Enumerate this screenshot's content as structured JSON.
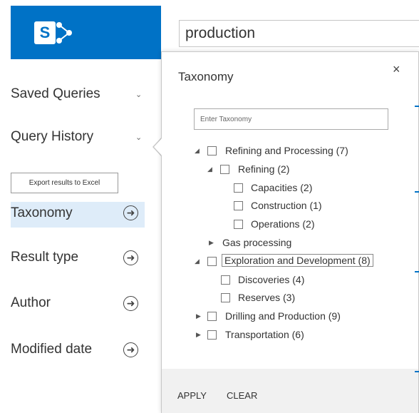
{
  "logo": {
    "letter": "S"
  },
  "search": {
    "query": "production"
  },
  "sidebar": {
    "saved_queries": "Saved Queries",
    "query_history": "Query History",
    "export_label": "Export results to Excel",
    "refiners": [
      {
        "label": "Taxonomy"
      },
      {
        "label": "Result type"
      },
      {
        "label": "Author"
      },
      {
        "label": "Modified date"
      }
    ]
  },
  "panel": {
    "title": "Taxonomy",
    "close": "×",
    "input_placeholder": "Enter Taxonomy",
    "tree": [
      {
        "label": "Refining and Processing (7)",
        "expanded": true
      },
      {
        "label": "Refining (2)",
        "expanded": true
      },
      {
        "label": "Capacities (2)"
      },
      {
        "label": "Construction (1)"
      },
      {
        "label": "Operations (2)"
      },
      {
        "label": "Gas processing",
        "expanded": false
      },
      {
        "label": "Exploration and Development (8)",
        "expanded": true,
        "focused": true
      },
      {
        "label": "Discoveries (4)"
      },
      {
        "label": "Reserves (3)"
      },
      {
        "label": "Drilling and Production (9)",
        "expanded": false
      },
      {
        "label": "Transportation (6)",
        "expanded": false
      }
    ],
    "apply": "APPLY",
    "clear": "CLEAR"
  },
  "colors": {
    "accent": "#0072c6",
    "highlight": "#deecf9"
  }
}
